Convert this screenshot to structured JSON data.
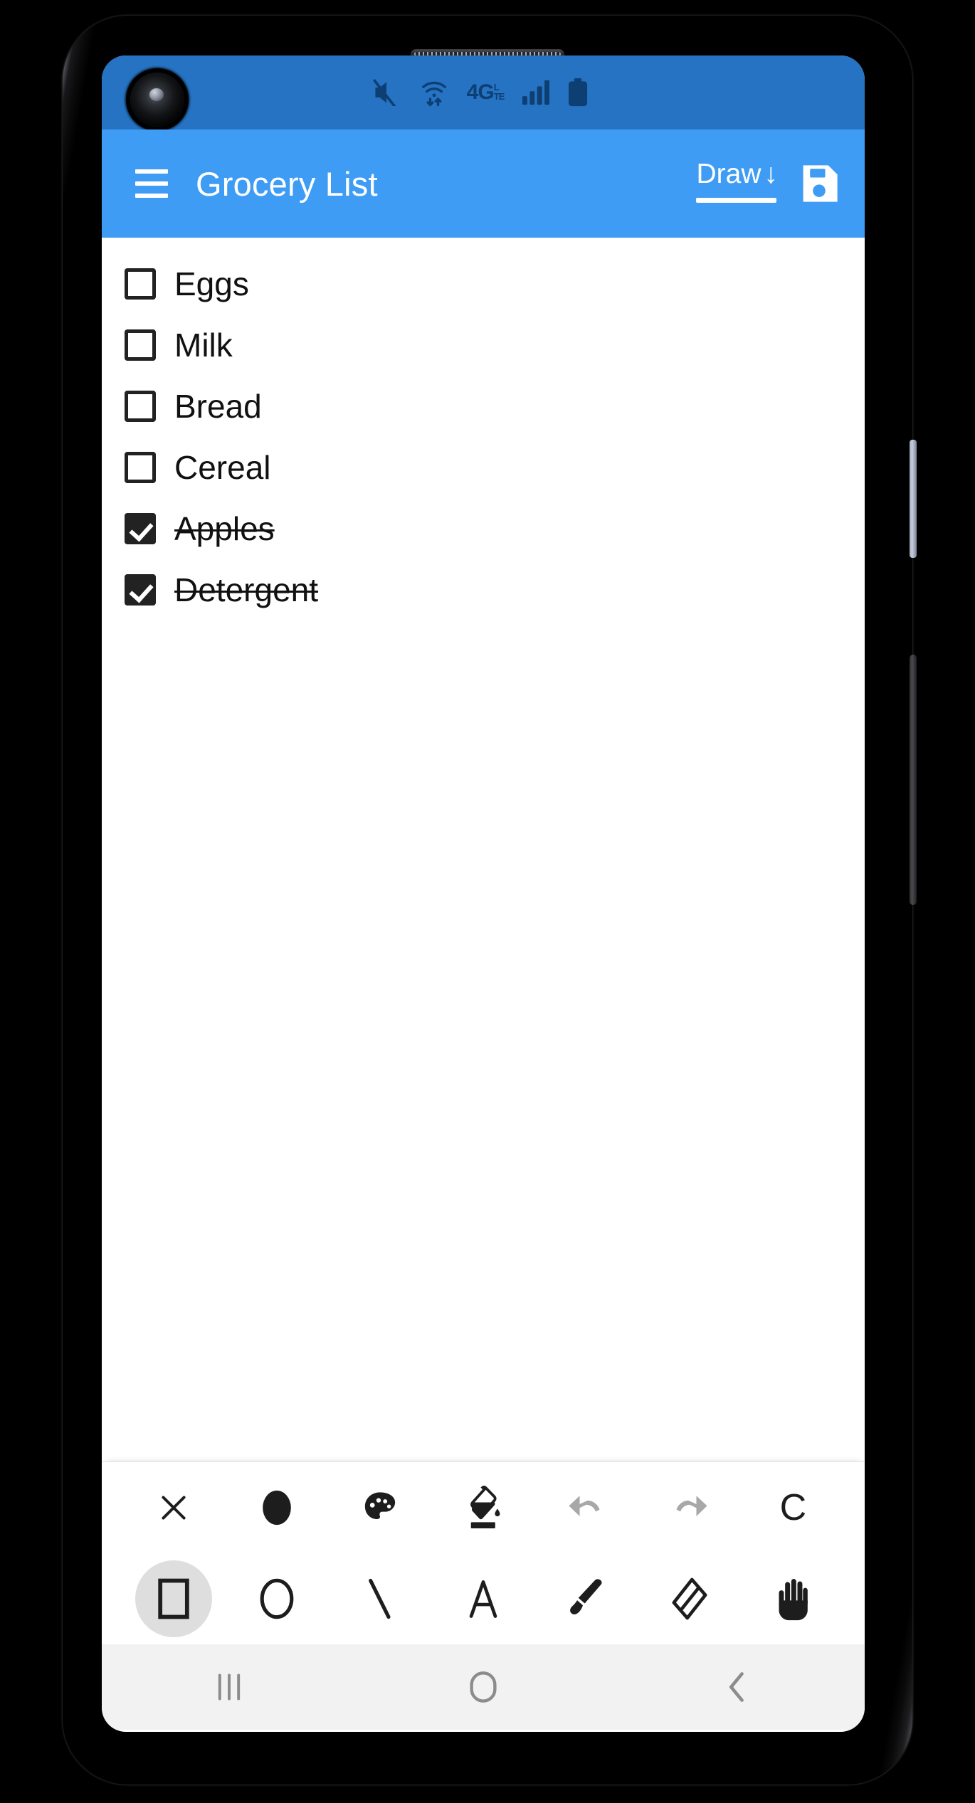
{
  "device": {
    "status_bar": {
      "icons": [
        "mute-icon",
        "wifi-transfer-icon",
        "network-4g-lte-icon",
        "signal-bars-icon",
        "battery-icon"
      ],
      "network_label": "4G",
      "network_sub_top": "L",
      "network_sub_bottom": "TE",
      "status_bar_color": "#2573c2"
    },
    "nav_bar": {
      "recents_label": "recents-icon",
      "home_label": "home-icon",
      "back_label": "back-icon"
    }
  },
  "app_bar": {
    "title": "Grocery List",
    "menu_label": "menu-icon",
    "draw_label": "Draw",
    "draw_arrow": "↓",
    "save_label": "save-icon",
    "accent_color": "#3f9cf5"
  },
  "checklist": {
    "items": [
      {
        "label": "Eggs",
        "checked": false
      },
      {
        "label": "Milk",
        "checked": false
      },
      {
        "label": "Bread",
        "checked": false
      },
      {
        "label": "Cereal",
        "checked": false
      },
      {
        "label": "Apples",
        "checked": true
      },
      {
        "label": "Detergent",
        "checked": true
      }
    ]
  },
  "draw_toolbar": {
    "row1": [
      {
        "name": "close-drawing-button",
        "icon": "close-icon",
        "glyph": "✕",
        "state": "enabled"
      },
      {
        "name": "brush-size-button",
        "icon": "filled-circle-icon",
        "glyph": "",
        "state": "enabled"
      },
      {
        "name": "color-palette-button",
        "icon": "palette-icon",
        "glyph": "",
        "state": "enabled"
      },
      {
        "name": "fill-bucket-button",
        "icon": "paint-bucket-icon",
        "glyph": "",
        "state": "enabled"
      },
      {
        "name": "undo-button",
        "icon": "undo-icon",
        "glyph": "",
        "state": "disabled"
      },
      {
        "name": "redo-button",
        "icon": "redo-icon",
        "glyph": "",
        "state": "disabled"
      },
      {
        "name": "clear-canvas-button",
        "icon": "clear-c-icon",
        "glyph": "C",
        "state": "enabled"
      }
    ],
    "row2": [
      {
        "name": "tool-rectangle",
        "icon": "rectangle-icon",
        "glyph": "",
        "state": "selected"
      },
      {
        "name": "tool-ellipse",
        "icon": "circle-icon",
        "glyph": "",
        "state": "enabled"
      },
      {
        "name": "tool-line",
        "icon": "line-icon",
        "glyph": "",
        "state": "enabled"
      },
      {
        "name": "tool-text",
        "icon": "text-a-icon",
        "glyph": "A",
        "state": "enabled"
      },
      {
        "name": "tool-brush",
        "icon": "paintbrush-icon",
        "glyph": "",
        "state": "enabled"
      },
      {
        "name": "tool-eraser",
        "icon": "eraser-icon",
        "glyph": "",
        "state": "enabled"
      },
      {
        "name": "tool-pan",
        "icon": "hand-icon",
        "glyph": "",
        "state": "enabled"
      }
    ]
  }
}
